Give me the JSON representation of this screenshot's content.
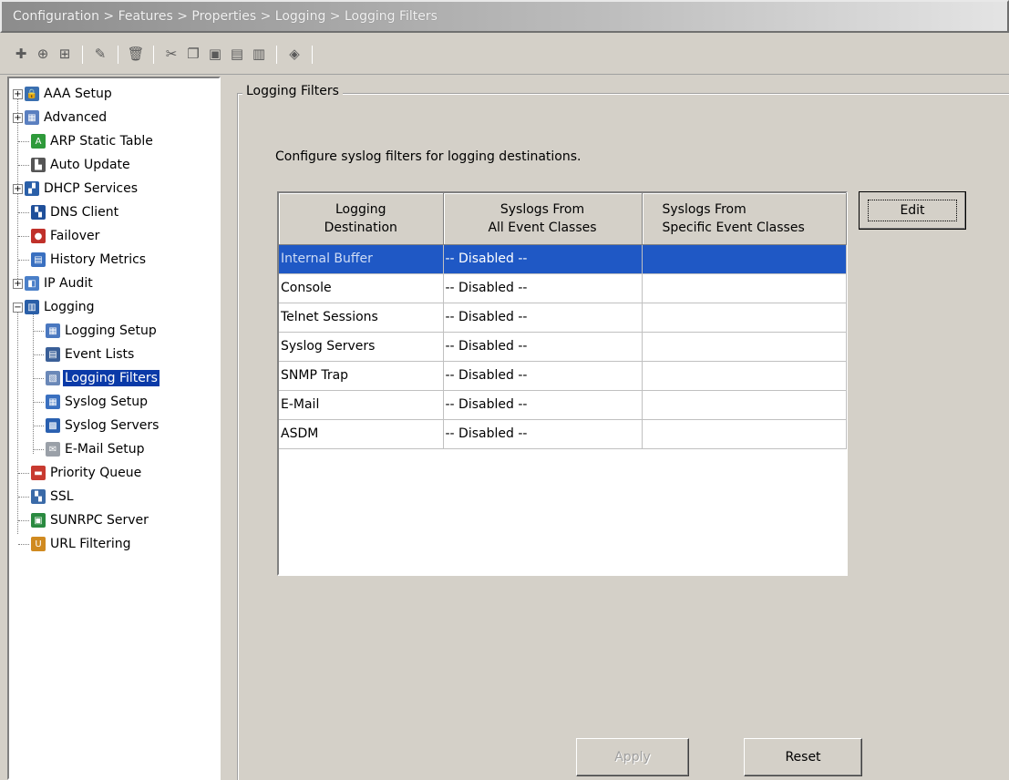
{
  "window": {
    "breadcrumb": "Configuration > Features > Properties > Logging > Logging Filters"
  },
  "toolbar": {
    "icons": [
      "add-icon",
      "insert-before-icon",
      "insert-after-icon",
      "edit-icon",
      "delete-icon",
      "cut-icon",
      "copy-icon",
      "paste-icon",
      "paste-before-icon",
      "paste-after-icon",
      "find-icon"
    ]
  },
  "tree": {
    "items": [
      {
        "label": "AAA Setup",
        "icon": "lock-icon"
      },
      {
        "label": "Advanced",
        "icon": "advanced-icon"
      },
      {
        "label": "ARP Static Table",
        "icon": "arp-icon"
      },
      {
        "label": "Auto Update",
        "icon": "auto-update-icon"
      },
      {
        "label": "DHCP Services",
        "icon": "dhcp-icon"
      },
      {
        "label": "DNS Client",
        "icon": "dns-icon"
      },
      {
        "label": "Failover",
        "icon": "failover-icon"
      },
      {
        "label": "History Metrics",
        "icon": "history-icon"
      },
      {
        "label": "IP Audit",
        "icon": "ip-audit-icon"
      },
      {
        "label": "Logging",
        "icon": "logging-icon"
      },
      {
        "label": "Logging Setup",
        "icon": "logging-setup-icon"
      },
      {
        "label": "Event Lists",
        "icon": "event-lists-icon"
      },
      {
        "label": "Logging Filters",
        "icon": "logging-filters-icon"
      },
      {
        "label": "Syslog Setup",
        "icon": "syslog-setup-icon"
      },
      {
        "label": "Syslog Servers",
        "icon": "syslog-servers-icon"
      },
      {
        "label": "E-Mail Setup",
        "icon": "email-icon"
      },
      {
        "label": "Priority Queue",
        "icon": "priority-queue-icon"
      },
      {
        "label": "SSL",
        "icon": "ssl-icon"
      },
      {
        "label": "SUNRPC Server",
        "icon": "sunrpc-icon"
      },
      {
        "label": "URL Filtering",
        "icon": "url-icon"
      }
    ]
  },
  "main": {
    "group_title": "Logging Filters",
    "description": "Configure syslog filters for logging destinations.",
    "table": {
      "headers": [
        [
          "Logging",
          "Destination"
        ],
        [
          "Syslogs From",
          "All Event Classes"
        ],
        [
          "Syslogs From",
          "Specific Event Classes"
        ]
      ],
      "rows": [
        [
          "Internal Buffer",
          "-- Disabled --",
          ""
        ],
        [
          "Console",
          "-- Disabled --",
          ""
        ],
        [
          "Telnet Sessions",
          "-- Disabled --",
          ""
        ],
        [
          "Syslog Servers",
          "-- Disabled --",
          ""
        ],
        [
          "SNMP Trap",
          "-- Disabled --",
          ""
        ],
        [
          "E-Mail",
          "-- Disabled --",
          ""
        ],
        [
          "ASDM",
          "-- Disabled --",
          ""
        ]
      ]
    },
    "edit_label": "Edit",
    "apply_label": "Apply",
    "reset_label": "Reset"
  },
  "colors": {
    "selection": "#1f58c5",
    "tree_selection": "#0a3aa8",
    "background": "#d4d0c8"
  }
}
